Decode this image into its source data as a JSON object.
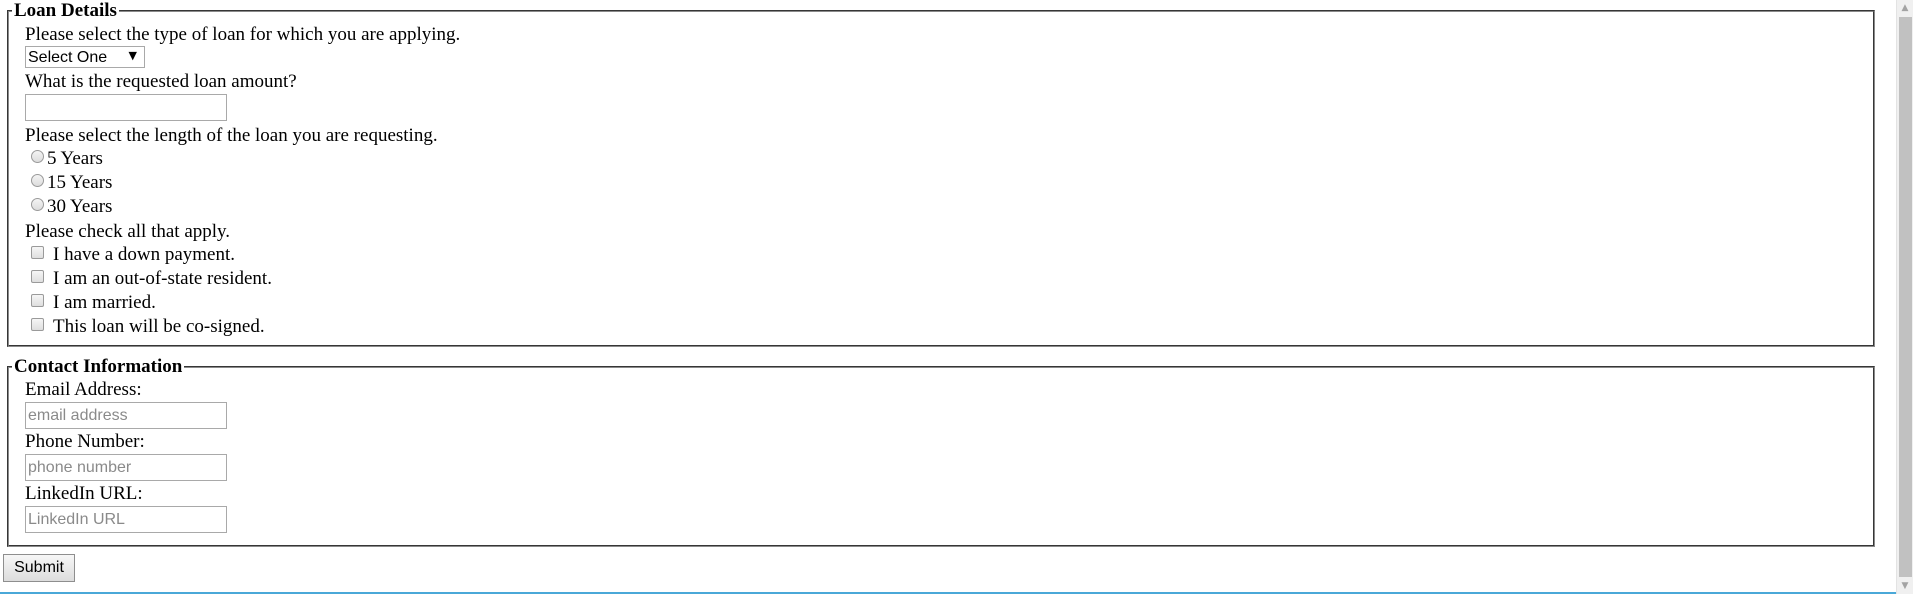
{
  "loan_details": {
    "legend": "Loan Details",
    "loan_type_question": "Please select the type of loan for which you are applying.",
    "loan_type_selected": "Select One",
    "amount_question": "What is the requested loan amount?",
    "amount_value": "",
    "length_question": "Please select the length of the loan you are requesting.",
    "length_options": [
      "5 Years",
      "15 Years",
      "30 Years"
    ],
    "check_question": "Please check all that apply.",
    "check_options": [
      "I have a down payment.",
      "I am an out-of-state resident.",
      "I am married.",
      "This loan will be co-signed."
    ]
  },
  "contact": {
    "legend": "Contact Information",
    "email_label": "Email Address:",
    "email_placeholder": "email address",
    "phone_label": "Phone Number:",
    "phone_placeholder": "phone number",
    "linkedin_label": "LinkedIn URL:",
    "linkedin_placeholder": "LinkedIn URL"
  },
  "submit_label": "Submit",
  "icons": {
    "select_arrow": "caret-down-icon",
    "scroll_up": "scroll-up-arrow-icon",
    "scroll_down": "scroll-down-arrow-icon"
  }
}
